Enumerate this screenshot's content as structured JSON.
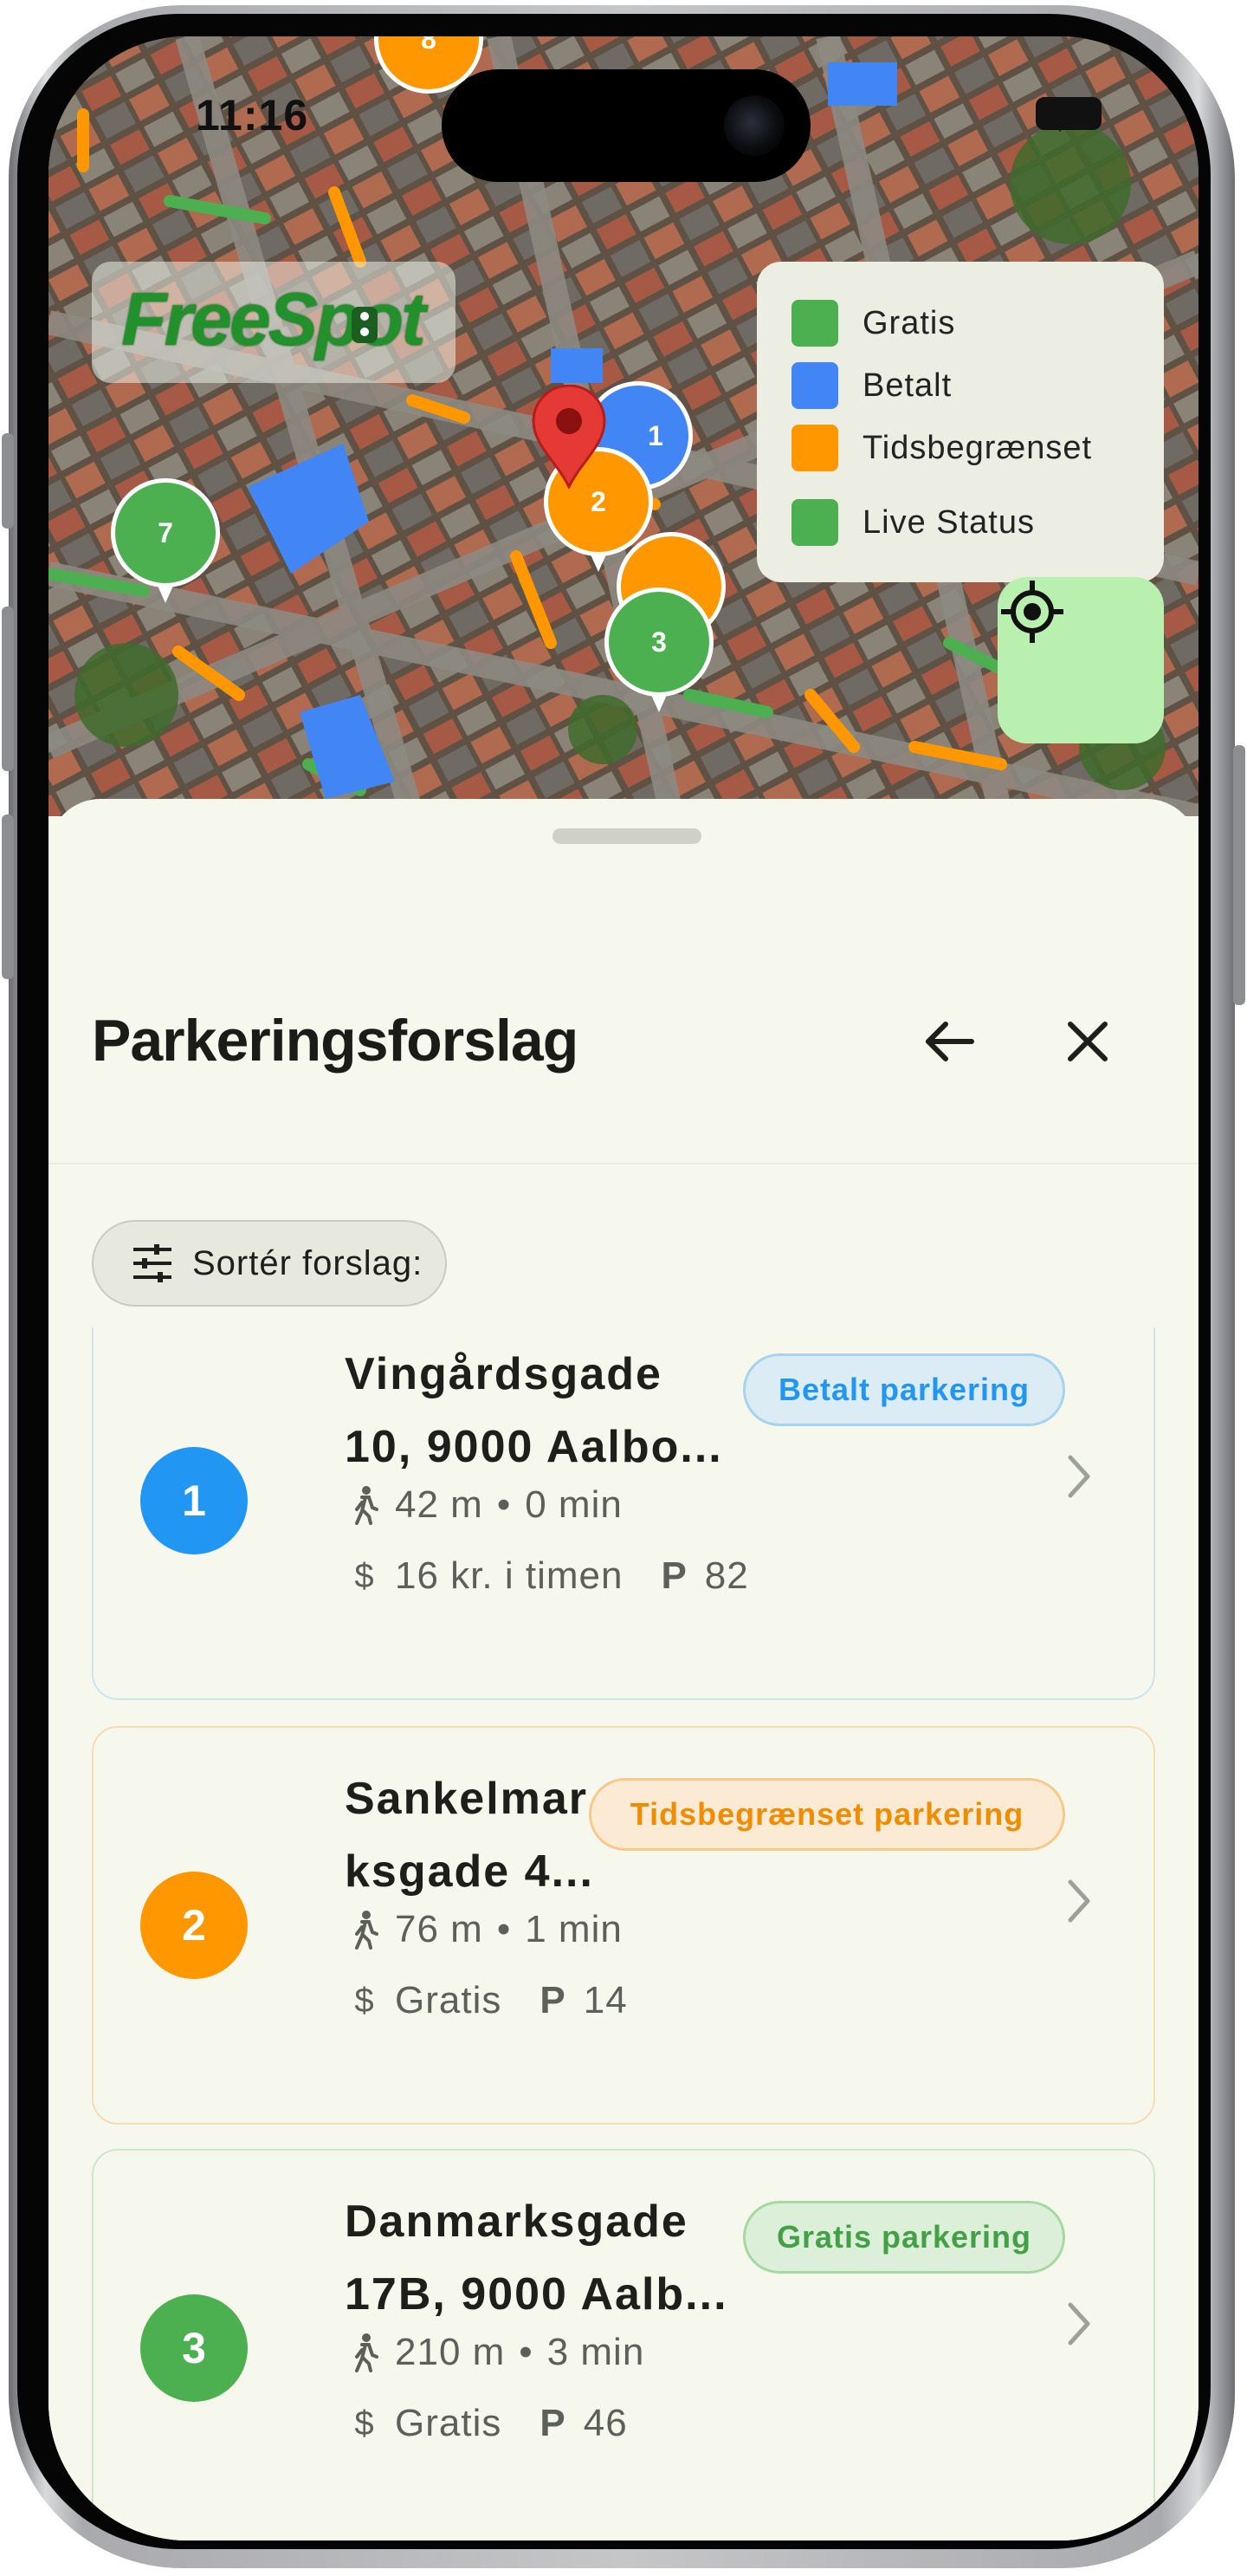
{
  "status_bar": {
    "time": "11:16"
  },
  "map": {
    "logo": "FreeSpot",
    "legend": [
      {
        "label": "Gratis",
        "color": "#4caf50"
      },
      {
        "label": "Betalt",
        "color": "#4285f4"
      },
      {
        "label": "Tidsbegrænset",
        "color": "#ff9800"
      },
      {
        "label": "Live Status",
        "color": "#4caf50"
      }
    ],
    "markers": [
      {
        "label": "8",
        "color": "#ff9800"
      },
      {
        "label": "1",
        "color": "#4285f4"
      },
      {
        "label": "2",
        "color": "#ff9800"
      },
      {
        "label": "3",
        "color": "#4caf50"
      },
      {
        "label": "7",
        "color": "#4caf50"
      }
    ]
  },
  "sheet": {
    "title": "Parkeringsforslag",
    "sort_label": "Sortér forslag:",
    "suggestions": [
      {
        "number": "1",
        "title_line1": "Vingårdsgade",
        "title_line2": "10, 9000 Aalbo...",
        "badge": "Betalt parkering",
        "distance": "42 m",
        "time": "0 min",
        "price": "16 kr. i timen",
        "spots": "82",
        "color": "#2196f3"
      },
      {
        "number": "2",
        "title_line1": "Sankelmar",
        "title_line2": "ksgade 4...",
        "badge": "Tidsbegrænset parkering",
        "distance": "76 m",
        "time": "1 min",
        "price": "Gratis",
        "spots": "14",
        "color": "#ff9800"
      },
      {
        "number": "3",
        "title_line1": "Danmarksgade",
        "title_line2": "17B, 9000 Aalb...",
        "badge": "Gratis parkering",
        "distance": "210 m",
        "time": "3 min",
        "price": "Gratis",
        "spots": "46",
        "color": "#4caf50"
      }
    ]
  }
}
